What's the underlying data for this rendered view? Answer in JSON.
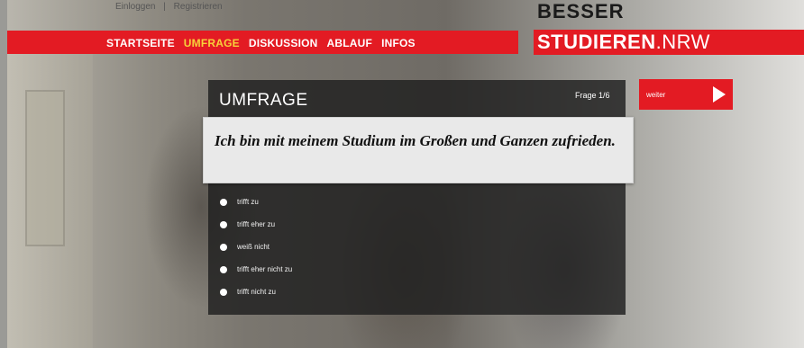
{
  "header": {
    "login_link": "Einloggen",
    "separator": "|",
    "register_link": "Registrieren"
  },
  "nav": {
    "items": [
      {
        "label": "STARTSEITE",
        "active": false
      },
      {
        "label": "UMFRAGE",
        "active": true
      },
      {
        "label": "DISKUSSION",
        "active": false
      },
      {
        "label": "ABLAUF",
        "active": false
      },
      {
        "label": "INFOS",
        "active": false
      }
    ]
  },
  "logo": {
    "line1": "BESSER",
    "line2_bold": "STUDIEREN",
    "line2_rest": ".NRW"
  },
  "survey": {
    "title": "UMFRAGE",
    "progress": "Frage 1/6",
    "next_label": "weiter",
    "question": "Ich bin mit meinem Studium im Großen und Ganzen zufrieden.",
    "options": [
      "trifft zu",
      "trifft eher zu",
      "weiß nicht",
      "trifft eher nicht zu",
      "trifft nicht zu"
    ]
  },
  "colors": {
    "brand_red": "#e31b23",
    "active_nav": "#f7d23a",
    "panel_bg": "#1e1e1e"
  },
  "icons": {
    "next": "arrow-right-icon",
    "option": "radio-icon"
  }
}
